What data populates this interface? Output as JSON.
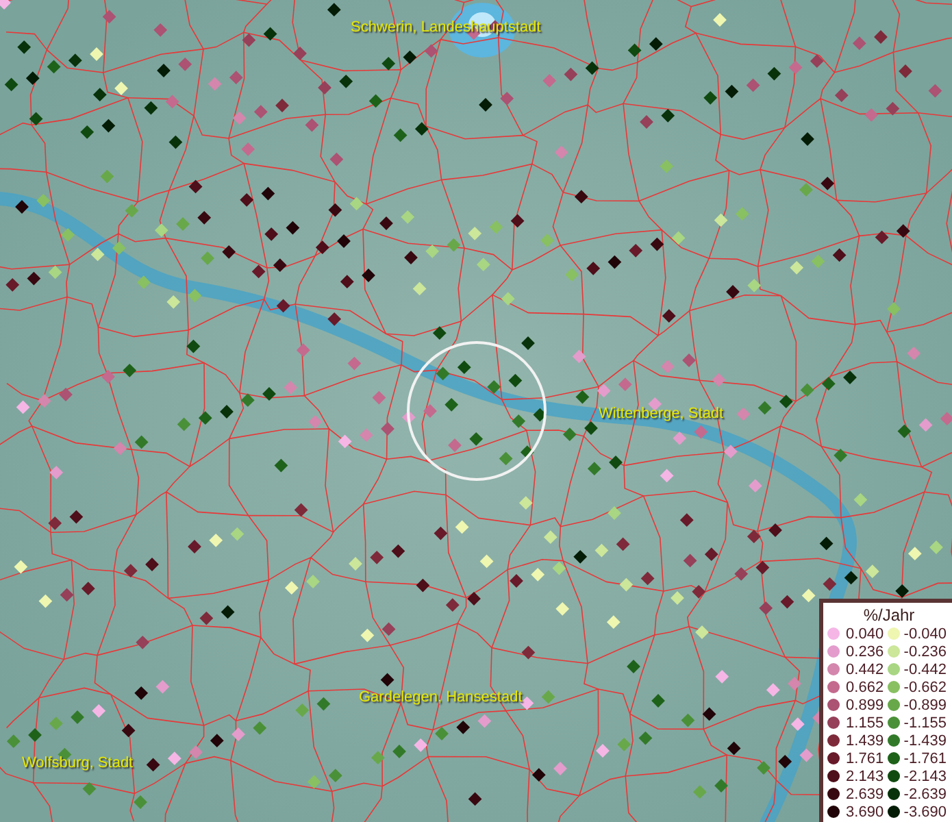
{
  "map": {
    "places": [
      {
        "name": "Schwerin, Landeshauptstadt"
      },
      {
        "name": "Wittenberge, Stadt"
      },
      {
        "name": "Gardelegen, Hansestadt"
      },
      {
        "name": "Wolfsburg, Stadt"
      }
    ]
  },
  "legend": {
    "title": "%/Jahr",
    "rows": [
      {
        "positive": {
          "value": "0.040",
          "color": "#f5b6e6"
        },
        "negative": {
          "value": "-0.040",
          "color": "#eef6b0"
        }
      },
      {
        "positive": {
          "value": "0.236",
          "color": "#e49ccc"
        },
        "negative": {
          "value": "-0.236",
          "color": "#cce69a"
        }
      },
      {
        "positive": {
          "value": "0.442",
          "color": "#d486ac"
        },
        "negative": {
          "value": "-0.442",
          "color": "#a8d682"
        }
      },
      {
        "positive": {
          "value": "0.662",
          "color": "#c46a8e"
        },
        "negative": {
          "value": "-0.662",
          "color": "#88c062"
        }
      },
      {
        "positive": {
          "value": "0.899",
          "color": "#ac5272"
        },
        "negative": {
          "value": "-0.899",
          "color": "#68a84a"
        }
      },
      {
        "positive": {
          "value": "1.155",
          "color": "#96405a"
        },
        "negative": {
          "value": "-1.155",
          "color": "#4a9038"
        }
      },
      {
        "positive": {
          "value": "1.439",
          "color": "#7e2a3a"
        },
        "negative": {
          "value": "-1.439",
          "color": "#327a2a"
        }
      },
      {
        "positive": {
          "value": "1.761",
          "color": "#681a2a"
        },
        "negative": {
          "value": "-1.761",
          "color": "#1e621a"
        }
      },
      {
        "positive": {
          "value": "2.143",
          "color": "#4e0e1a"
        },
        "negative": {
          "value": "-2.143",
          "color": "#104a10"
        }
      },
      {
        "positive": {
          "value": "2.639",
          "color": "#380810"
        },
        "negative": {
          "value": "-2.639",
          "color": "#08320a"
        }
      },
      {
        "positive": {
          "value": "3.690",
          "color": "#200408"
        },
        "negative": {
          "value": "-3.690",
          "color": "#041c06"
        }
      }
    ]
  }
}
